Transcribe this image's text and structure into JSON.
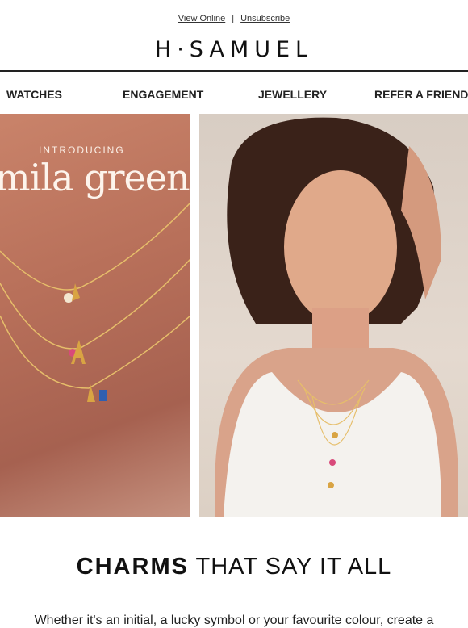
{
  "header": {
    "view_online": "View Online",
    "separator": "|",
    "unsubscribe": "Unsubscribe",
    "logo": "H·SAMUEL"
  },
  "nav": {
    "items": [
      {
        "label": "WATCHES"
      },
      {
        "label": "ENGAGEMENT"
      },
      {
        "label": "JEWELLERY"
      },
      {
        "label": "REFER A FRIEND"
      }
    ]
  },
  "hero": {
    "intro": "INTRODUCING",
    "brand": "mila green"
  },
  "section": {
    "headline_bold": "CHARMS",
    "headline_rest": "THAT SAY IT ALL",
    "body": "Whether it's an initial, a lucky symbol or your favourite colour, create a"
  },
  "colors": {
    "text": "#1a1a1a",
    "hero_left": "#b8705a",
    "hero_right": "#e4d9cf",
    "gold": "#d4a94a"
  }
}
